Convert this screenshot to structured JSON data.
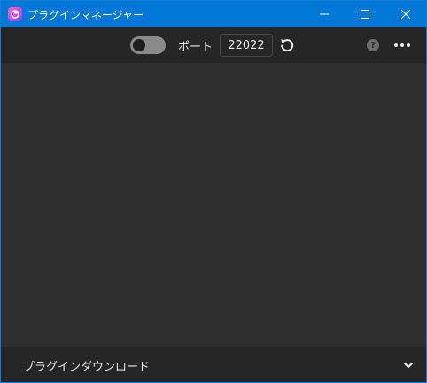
{
  "titlebar": {
    "title": "プラグインマネージャー",
    "app_icon": "plugin-manager-app-icon"
  },
  "toolbar": {
    "server_toggle_on": false,
    "port_label": "ポート",
    "port_value": "22022",
    "refresh_icon": "refresh-icon",
    "help_glyph": "?",
    "more_icon": "more-horizontal-icon"
  },
  "bottom_bar": {
    "label": "プラグインダウンロード",
    "expand_icon": "chevron-down-icon"
  },
  "colors": {
    "titlebar_bg": "#0078d7",
    "toolbar_bg": "#262626",
    "content_bg": "#2f2f2f",
    "toggle_track": "#8a8a8a"
  }
}
